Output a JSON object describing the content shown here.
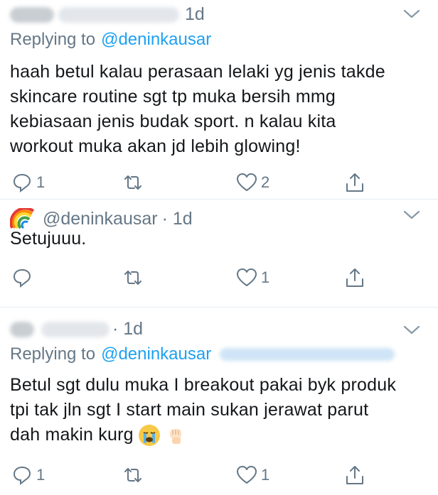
{
  "tweets": [
    {
      "time": "1d",
      "replying_label": "Replying to",
      "replying_handle": "@deninkausar",
      "lines": [
        "haah betul kalau perasaan lelaki yg jenis takde",
        "skincare routine sgt tp muka bersih mmg",
        "kebiasaan jenis budak sport. n kalau kita",
        "workout muka akan jd lebih glowing!"
      ],
      "replies": "1",
      "retweets": "",
      "likes": "2"
    },
    {
      "handle": "@deninkausar",
      "time": "· 1d",
      "lines": [
        "Setujuuu."
      ],
      "replies": "",
      "retweets": "",
      "likes": "1"
    },
    {
      "time": "· 1d",
      "replying_label": "Replying to",
      "replying_handle": "@deninkausar",
      "lines": [
        "Betul sgt dulu muka I breakout pakai byk produk",
        "tpi tak jln sgt I start main sukan jerawat parut",
        "dah makin kurg"
      ],
      "replies": "1",
      "retweets": "",
      "likes": "1"
    }
  ],
  "icons": {
    "reply": "reply-icon",
    "retweet": "retweet-icon",
    "like": "heart-icon",
    "share": "share-icon",
    "menu": "chevron-down-icon",
    "emoji1": "crying-face-emoji",
    "emoji2": "raised-fist-emoji",
    "avatar": "rainbow-emoji"
  },
  "colors": {
    "link": "#1da1f2",
    "secondary": "#657786",
    "divider": "#e6ecf0"
  }
}
